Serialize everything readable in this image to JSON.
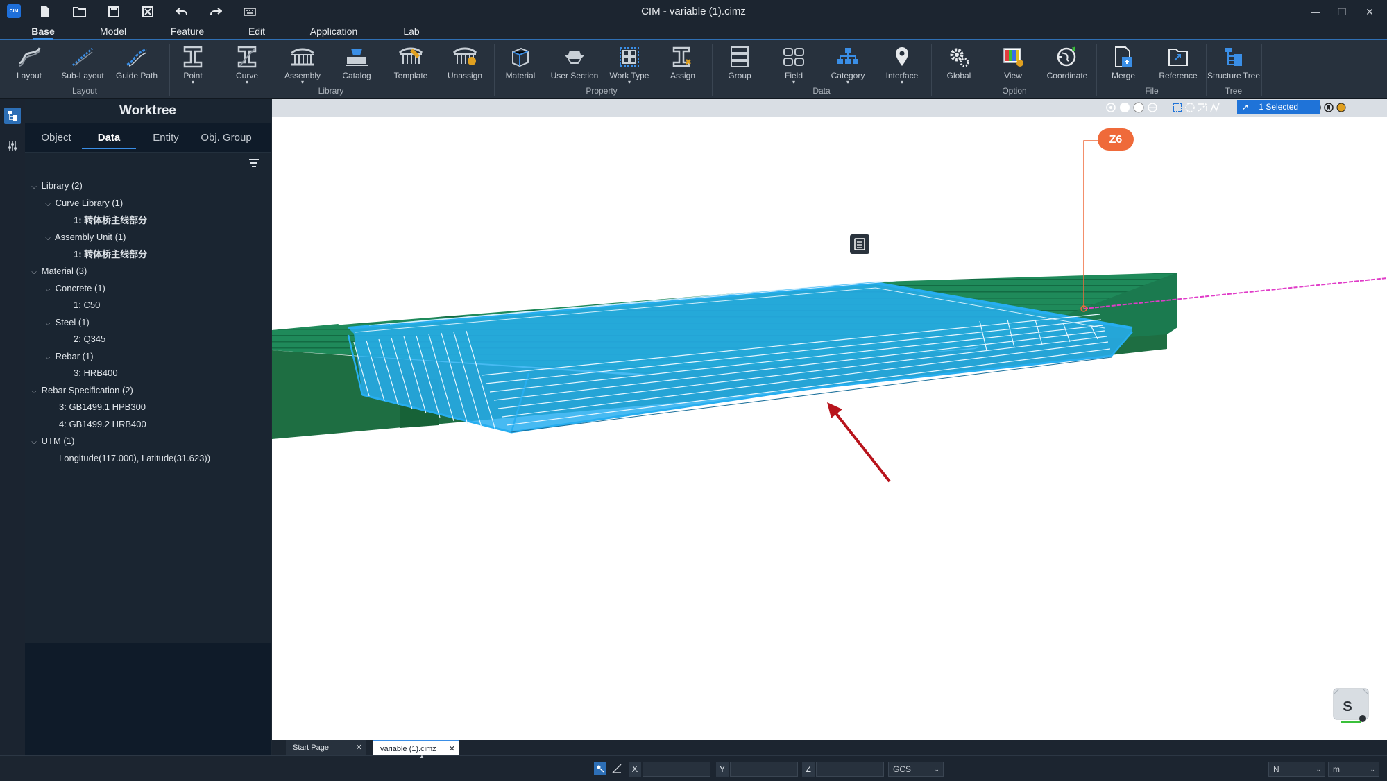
{
  "app": {
    "logo_text": "CIM",
    "title": "CIM - variable (1).cimz"
  },
  "menu_tabs": [
    "Base",
    "Model",
    "Feature",
    "Edit",
    "Application",
    "Lab"
  ],
  "ribbon": {
    "buttons": [
      "Layout",
      "Sub-Layout",
      "Guide Path",
      "Point",
      "Curve",
      "Assembly",
      "Catalog",
      "Template",
      "Unassign",
      "Material",
      "User Section",
      "Work Type",
      "Assign",
      "Group",
      "Field",
      "Category",
      "Interface",
      "Global",
      "View",
      "Coordinate",
      "Merge",
      "Reference",
      "Structure Tree"
    ],
    "groups": [
      "Layout",
      "Library",
      "Property",
      "Data",
      "Option",
      "File",
      "Tree"
    ]
  },
  "worktree": {
    "title": "Worktree",
    "tabs": [
      "Object",
      "Data",
      "Entity",
      "Obj. Group"
    ],
    "active_tab": "Data",
    "tree": [
      "Library (2)",
      "Curve Library (1)",
      "1: 转体桥主线部分",
      "Assembly Unit (1)",
      "1: 转体桥主线部分",
      "Material (3)",
      "Concrete (1)",
      "1: C50",
      "Steel (1)",
      "2: Q345",
      "Rebar (1)",
      "3: HRB400",
      "Rebar Specification (2)",
      "3: GB1499.1 HPB300",
      "4: GB1499.2 HRB400",
      "UTM (1)",
      "Longitude(117.000), Latitude(31.623))"
    ]
  },
  "viewport": {
    "selection": "1 Selected",
    "pier_label": "Z6",
    "badge_letter": "S",
    "colors": {
      "deck": "#1f8a5a",
      "selected": "#27aef0",
      "marker": "#ef6a3a",
      "axis_line": "#e03cc8",
      "arrow": "#b8141c"
    }
  },
  "doc_tabs": [
    "Start Page",
    "variable (1).cimz"
  ],
  "status": {
    "x_label": "X",
    "y_label": "Y",
    "z_label": "Z",
    "coord_system": "GCS",
    "north": "N",
    "unit": "m"
  }
}
